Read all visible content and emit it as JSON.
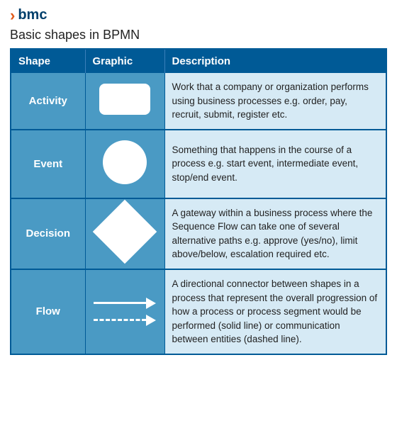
{
  "logo": {
    "icon": "›",
    "text": "bmc"
  },
  "page_title": "Basic shapes in BPMN",
  "table": {
    "headers": [
      "Shape",
      "Graphic",
      "Description"
    ],
    "rows": [
      {
        "shape": "Activity",
        "graphic_type": "rectangle",
        "description": "Work that a company or organization performs using business processes e.g. order, pay, recruit, submit, register etc."
      },
      {
        "shape": "Event",
        "graphic_type": "circle",
        "description": "Something that happens in the course of a process e.g. start event, intermediate event, stop/end event."
      },
      {
        "shape": "Decision",
        "graphic_type": "diamond",
        "description": "A gateway within a business process where the Sequence Flow can take one of several alternative paths e.g. approve (yes/no), limit above/below, escalation required etc."
      },
      {
        "shape": "Flow",
        "graphic_type": "arrows",
        "description": "A directional connector between shapes in a process that represent the overall progression of how a process or process segment would be performed (solid line) or communication between entities (dashed line)."
      }
    ]
  }
}
